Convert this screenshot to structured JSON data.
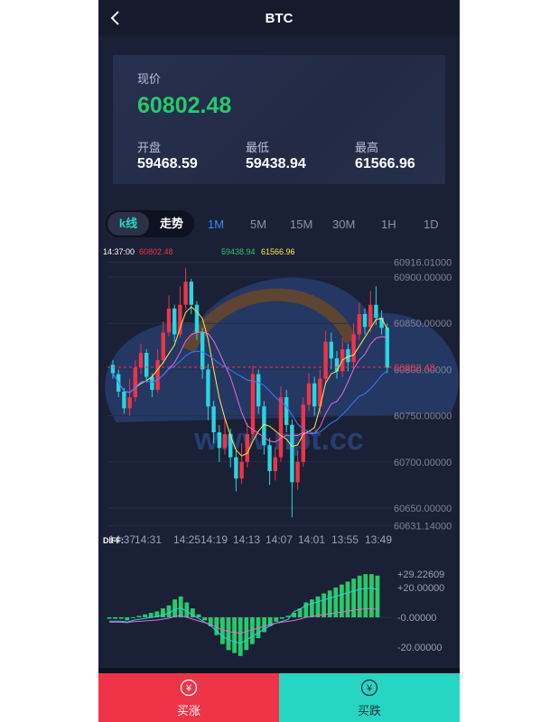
{
  "header": {
    "title": "BTC",
    "back_icon": "chevron-left-icon"
  },
  "price_card": {
    "current_label": "现价",
    "current_price": "60802.48",
    "open_label": "开盘",
    "open_value": "59468.59",
    "low_label": "最低",
    "low_value": "59438.94",
    "high_label": "最高",
    "high_value": "61566.96",
    "price_color": "#27c96b"
  },
  "tabs": {
    "kline_label": "k线",
    "trend_label": "走势",
    "periods": [
      "1M",
      "5M",
      "15M",
      "30M",
      "1H",
      "1D"
    ],
    "active_period": "1M"
  },
  "chart_data": {
    "type": "candlestick",
    "info_time": "14:37:00",
    "info_values": [
      "60802.48",
      "",
      "59438.94",
      "61566.96"
    ],
    "info_colors": [
      "#ef3447",
      "#3050ff",
      "#27c96b",
      "#ffe94a"
    ],
    "price_axis_labels": [
      "60916.01000",
      "60900.00000",
      "60850.00000",
      "60800.00000",
      "60750.00000",
      "60700.00000",
      "60650.00000",
      "60631.14000"
    ],
    "current_price_marker": "60802.48",
    "time_axis_labels": [
      "14:37",
      "14:31",
      "14:25",
      "14:19",
      "14:13",
      "14:07",
      "14:01",
      "13:55",
      "13:49"
    ],
    "macd_label": "DIFF:",
    "macd_axis_labels": [
      "+29.22609",
      "+20.00000",
      "-0.00000",
      "-20.00000"
    ],
    "up_color": "#ef3447",
    "down_color": "#2ad4e0"
  },
  "watermark": {
    "text": "www.npt.cc"
  },
  "buttons": {
    "buy_up_label": "买涨",
    "buy_down_label": "买跌",
    "icon": "yen-circle-icon"
  }
}
